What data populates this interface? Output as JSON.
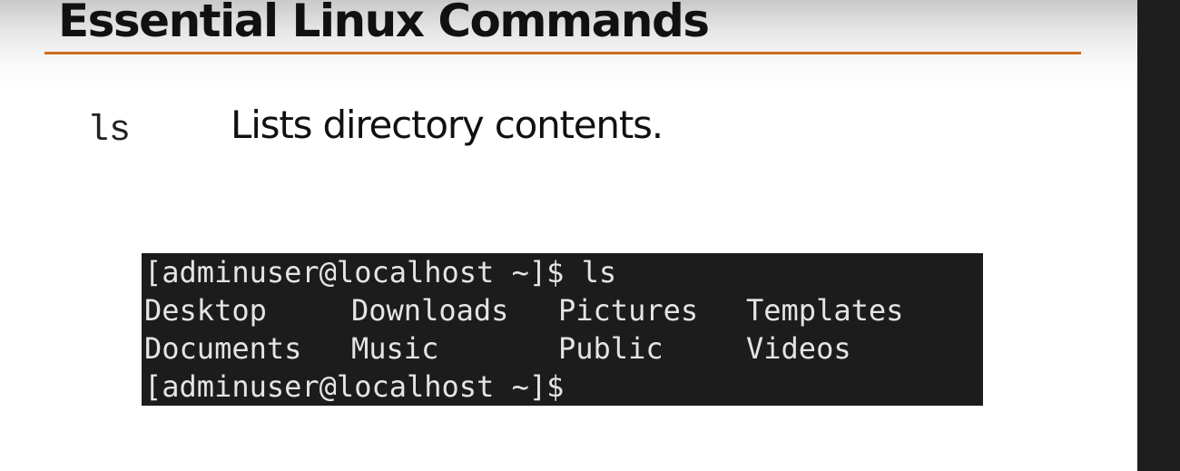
{
  "slide": {
    "title": "Essential Linux Commands",
    "accent_color": "#d06b1c",
    "command": {
      "name": "ls",
      "description": "Lists directory contents."
    },
    "terminal": {
      "background": "#1c1c1c",
      "prompt_line": "[adminuser@localhost ~]$ ls",
      "output_rows": [
        [
          "Desktop",
          "Downloads",
          "Pictures",
          "Templates"
        ],
        [
          "Documents",
          "Music",
          "Public",
          "Videos"
        ]
      ],
      "final_prompt": "[adminuser@localhost ~]$"
    }
  }
}
